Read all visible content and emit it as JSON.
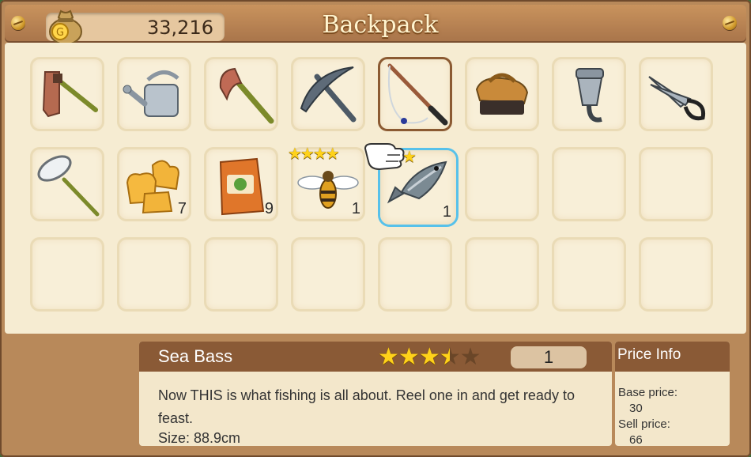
{
  "header": {
    "title": "Backpack",
    "gold": "33,216",
    "icons": {
      "bag": "money-bag-icon",
      "screws": "screw-icon"
    }
  },
  "inventory": {
    "row1": [
      {
        "name": "hoe",
        "icon": "hoe-icon"
      },
      {
        "name": "watering-can",
        "icon": "watering-can-icon"
      },
      {
        "name": "axe",
        "icon": "axe-icon"
      },
      {
        "name": "pickaxe",
        "icon": "pickaxe-icon"
      },
      {
        "name": "fishing-rod",
        "icon": "fishing-rod-icon",
        "selected": true
      },
      {
        "name": "brush",
        "icon": "brush-icon"
      },
      {
        "name": "milker",
        "icon": "milker-icon"
      },
      {
        "name": "shears",
        "icon": "shears-icon"
      }
    ],
    "row2": [
      {
        "name": "bug-net",
        "icon": "bug-net-icon"
      },
      {
        "name": "animal-crackers",
        "icon": "animal-crackers-icon",
        "qty": "7"
      },
      {
        "name": "seed-bag",
        "icon": "seed-bag-icon",
        "qty": "9"
      },
      {
        "name": "bee",
        "icon": "bee-icon",
        "qty": "1",
        "stars": "★★★★"
      },
      {
        "name": "sea-bass",
        "icon": "fish-icon",
        "qty": "1",
        "stars": "★★★",
        "hovered": true
      }
    ]
  },
  "details": {
    "name": "Sea Bass",
    "rating": 3.5,
    "rating_max": 5,
    "count": "1",
    "description": "Now THIS is what fishing is all about. Reel one in and get ready to feast.",
    "size": "Size: 88.9cm"
  },
  "price_info": {
    "title": "Price Info",
    "base_label": "Base price:",
    "base_value": "30",
    "sell_label": "Sell price:",
    "sell_value": "66"
  },
  "colors": {
    "hover_border": "#57c1ea",
    "selected_border": "#8b5a32",
    "star": "#ffd21a"
  }
}
